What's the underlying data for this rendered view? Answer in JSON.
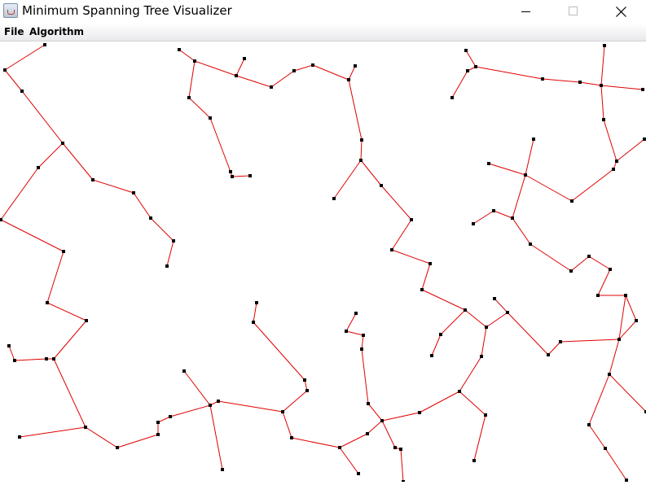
{
  "window": {
    "title": "Minimum Spanning Tree Visualizer",
    "icon": "java-cup-icon"
  },
  "menubar": {
    "items": [
      {
        "label": "File"
      },
      {
        "label": "Algorithm"
      }
    ]
  },
  "graph": {
    "edge_color": "#e00000",
    "node_color": "#000000"
  }
}
